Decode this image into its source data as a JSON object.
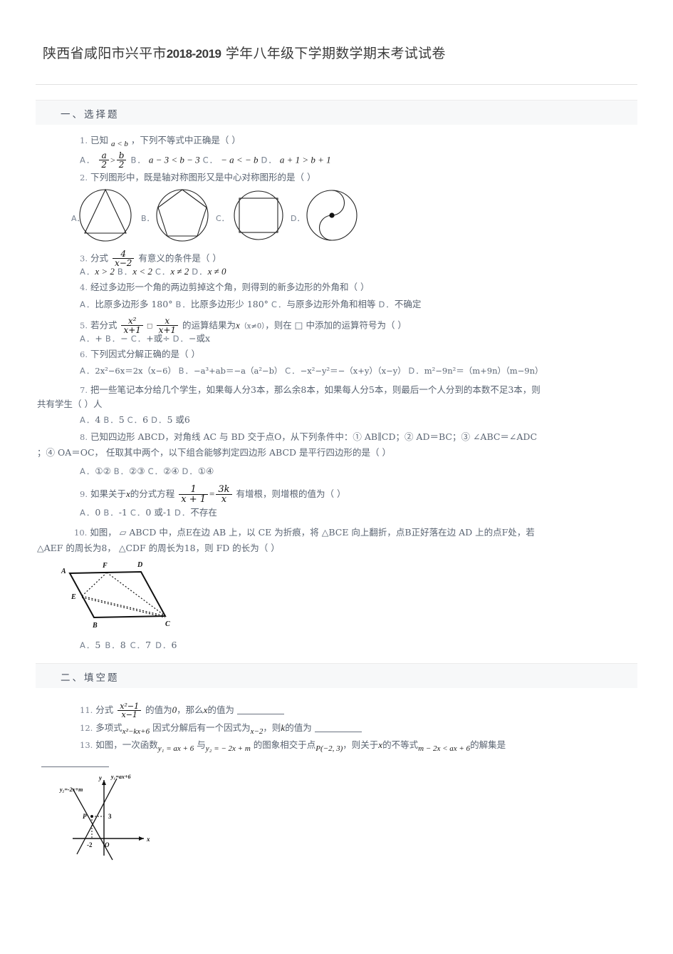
{
  "document": {
    "title_prefix": "陕西省咸阳市兴平市",
    "title_year": "2018-2019",
    "title_suffix": "学年八年级下学期数学期末考试试卷"
  },
  "sections": [
    {
      "id": "choice",
      "label": "一、选择题"
    },
    {
      "id": "fill",
      "label": "二、填空题"
    }
  ],
  "questions": [
    {
      "num": "1.",
      "stem_a": "已知",
      "stem_math": "a < b",
      "stem_b": "，下列不等式中正确是（  ）",
      "options": [
        {
          "letter": "A．",
          "text": "a/2 > b/2"
        },
        {
          "letter": "B．",
          "text": "a − 3 < b − 3"
        },
        {
          "letter": "C．",
          "text": "− a < − b"
        },
        {
          "letter": "D．",
          "text": "a + 1 > b + 1"
        }
      ]
    },
    {
      "num": "2.",
      "stem": "下列图形中，既是轴对称图形又是中心对称图形的是（  ）",
      "options": [
        {
          "letter": "A．",
          "icon": "circle-triangle-icon"
        },
        {
          "letter": "B．",
          "icon": "circle-pentagon-icon"
        },
        {
          "letter": "C．",
          "icon": "circle-square-icon"
        },
        {
          "letter": "D．",
          "icon": "circle-yinyang-icon"
        }
      ]
    },
    {
      "num": "3.",
      "stem_a": "分式",
      "frac_top": "4",
      "frac_bot": "x−2",
      "stem_b": "有意义的条件是（  ）",
      "options": [
        {
          "letter": "A．",
          "text": "x > 2"
        },
        {
          "letter": "B．",
          "text": "x < 2"
        },
        {
          "letter": "C．",
          "text": "x ≠ 2"
        },
        {
          "letter": "D．",
          "text": "x ≠ 0"
        }
      ]
    },
    {
      "num": "4.",
      "stem": "经过多边形一个角的两边剪掉这个角，则得到的新多边形的外角和（  ）",
      "options": [
        {
          "letter": "A．",
          "text": "比原多边形多 180°"
        },
        {
          "letter": "B．",
          "text": "比原多边形少 180°"
        },
        {
          "letter": "C．",
          "text": "与原多边形外角和相等"
        },
        {
          "letter": "D．",
          "text": "不确定"
        }
      ]
    },
    {
      "num": "5.",
      "stem_a": "若分式",
      "frac1_top": "x²",
      "frac1_bot": "x+1",
      "boxop": "□",
      "frac2_top": "x",
      "frac2_bot": "x+1",
      "stem_b": "的运算结果为",
      "stem_var": "x",
      "stem_cond": "（x≠0）",
      "stem_c": "，则在 □ 中添加的运算符号为（  ）",
      "options": [
        {
          "letter": "A．",
          "text": "+"
        },
        {
          "letter": "B．",
          "text": "−"
        },
        {
          "letter": "C．",
          "text": "+或÷"
        },
        {
          "letter": "D．",
          "text": "−或x"
        }
      ]
    },
    {
      "num": "6.",
      "stem": "下列因式分解正确的是（  ）",
      "options": [
        {
          "letter": "A．",
          "text": "2x²−6x＝2x（x−6）"
        },
        {
          "letter": "B．",
          "text": "−a³+ab＝−a（a²−b）"
        },
        {
          "letter": "C．",
          "text": "−x²−y²＝−（x+y）（x−y）"
        },
        {
          "letter": "D．",
          "text": "m²−9n²＝（m+9n）（m−9n）"
        }
      ]
    },
    {
      "num": "7.",
      "stem_line1": "把一些笔记本分给几个学生，如果每人分3本，那么余8本，如果每人分5本，则最后一个人分到的本数不足3本，则",
      "stem_line2": "共有学生（  ）人",
      "options": [
        {
          "letter": "A．",
          "text": "4"
        },
        {
          "letter": "B．",
          "text": "5"
        },
        {
          "letter": "C．",
          "text": "6"
        },
        {
          "letter": "D．",
          "text": "5 或6"
        }
      ]
    },
    {
      "num": "8.",
      "stem_line1": "已知四边形 ABCD，对角线 AC 与 BD 交于点O，从下列条件中：① AB∥CD；② AD＝BC；③ ∠ABC＝∠ADC",
      "stem_line2": "；④ OA＝OC， 任取其中两个，以下组合能够判定四边形 ABCD 是平行四边形的是（  ）",
      "options": [
        {
          "letter": "A．",
          "text": "①②"
        },
        {
          "letter": "B．",
          "text": "②③"
        },
        {
          "letter": "C．",
          "text": "②④"
        },
        {
          "letter": "D．",
          "text": "①④"
        }
      ]
    },
    {
      "num": "9.",
      "stem_a": "如果关于",
      "stem_var": "x",
      "stem_b": "的分式方程",
      "eq_lhs_top": "1",
      "eq_lhs_bot": "x + 1",
      "eq_sign": "=",
      "eq_rhs_top": "3k",
      "eq_rhs_bot": "x",
      "stem_c": "有增根，则增根的值为（  ）",
      "options": [
        {
          "letter": "A．",
          "text": "0"
        },
        {
          "letter": "B．",
          "text": "-1"
        },
        {
          "letter": "C．",
          "text": "0 或-1"
        },
        {
          "letter": "D．",
          "text": "不存在"
        }
      ]
    },
    {
      "num": "10.",
      "stem_line1": "如图， ▱ ABCD 中，点E在边 AB 上，以 CE 为折痕，将 △BCE 向上翻折，点B正好落在边 AD 上的点F处，若",
      "stem_line2": "△AEF 的周长为8， △CDF 的周长为18，则 FD 的长为（  ）",
      "figure": "parallelogram-fold-figure",
      "figure_labels": [
        "A",
        "F",
        "D",
        "E",
        "B",
        "C"
      ],
      "options": [
        {
          "letter": "A．",
          "text": "5"
        },
        {
          "letter": "B．",
          "text": "8"
        },
        {
          "letter": "C．",
          "text": "7"
        },
        {
          "letter": "D．",
          "text": "6"
        }
      ]
    },
    {
      "num": "11.",
      "stem_a": "分式",
      "frac_top": "x²−1",
      "frac_bot": "x−1",
      "stem_b": "的值为",
      "val0": "0",
      "stem_c": "，那么",
      "stem_var": "x",
      "stem_d": "的值为",
      "blank": "________"
    },
    {
      "num": "12.",
      "stem_a": "多项式",
      "expr": "x²−kx+6",
      "stem_b": "因式分解后有一个因式为",
      "factor": "x−2",
      "stem_c": "，则",
      "stem_var": "k",
      "stem_d": "的值为",
      "blank": "________"
    },
    {
      "num": "13.",
      "stem_a": "如图，一次函数",
      "fn1": "y₁ = ax + 6",
      "stem_b": "与",
      "fn2": "y₂ = − 2x + m",
      "stem_c": "的图象相交于点",
      "point": "P(−2, 3)",
      "stem_d": "，则关于",
      "stem_var": "x",
      "stem_e": "的不等式",
      "ineq": "m − 2x < ax + 6",
      "stem_f": "的解集是",
      "blank": "________",
      "figure": "linear-functions-graph",
      "figure_labels": {
        "y_axis": "y",
        "x_axis": "x",
        "origin": "O",
        "line1": "y₁=ax+6",
        "line2": "y₂=-2x+m",
        "point": "P",
        "y_value": "3",
        "x_value": "-2"
      }
    }
  ],
  "colors": {
    "text": "#5a6472",
    "math": "#1d1d1d",
    "section_bg": "#f7f8f9",
    "rule": "#e2e2e2",
    "title": "#3a3a3a"
  }
}
